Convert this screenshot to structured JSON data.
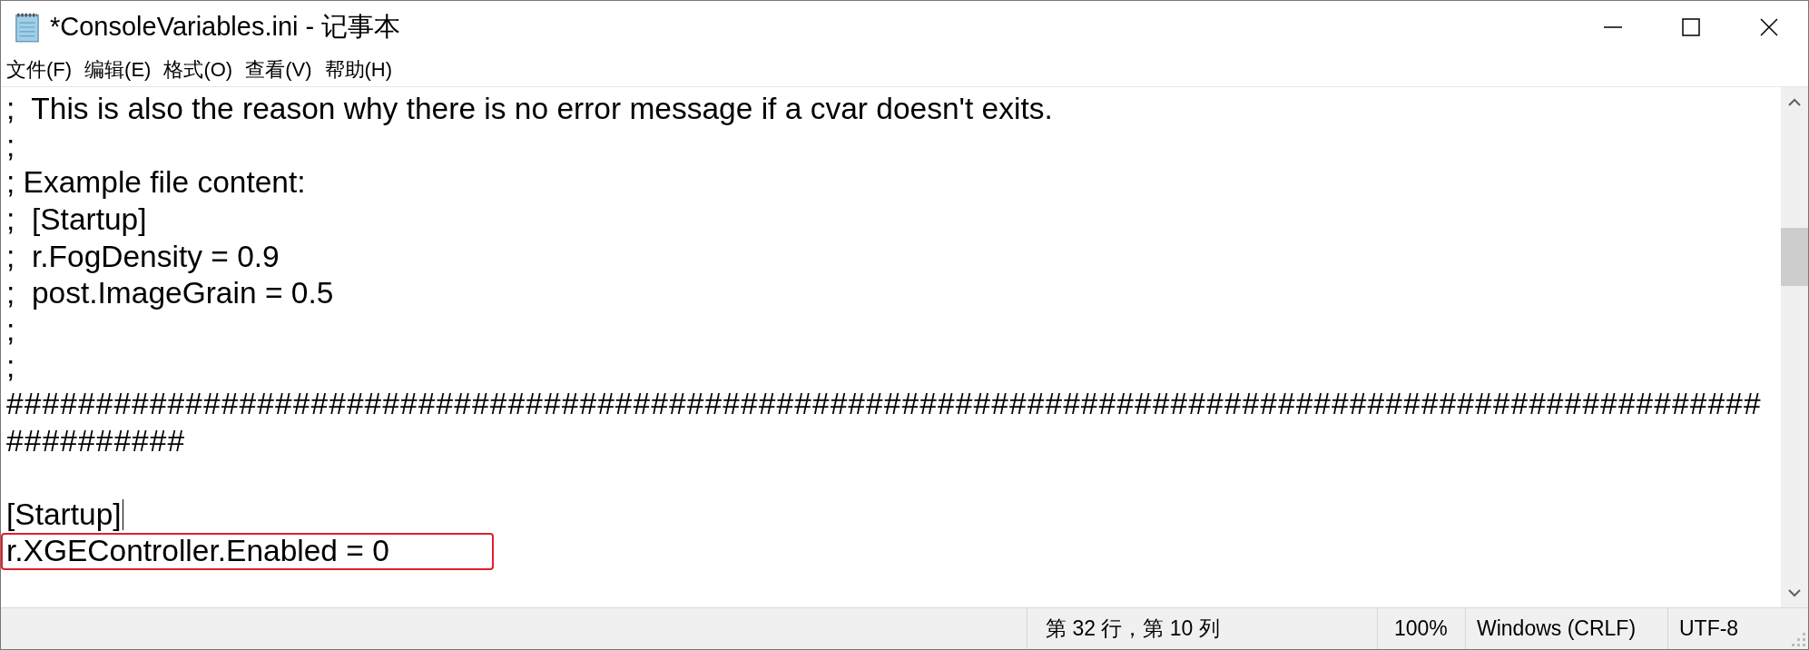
{
  "window": {
    "title": "*ConsoleVariables.ini - 记事本"
  },
  "menu": [
    {
      "label": "文件(F)"
    },
    {
      "label": "编辑(E)"
    },
    {
      "label": "格式(O)"
    },
    {
      "label": "查看(V)"
    },
    {
      "label": "帮助(H)"
    }
  ],
  "editor": {
    "lines": [
      {
        "kind": "text",
        "text": ";  This is also the reason why there is no error message if a cvar doesn't exits."
      },
      {
        "kind": "text",
        "text": ";"
      },
      {
        "kind": "text",
        "text": "; Example file content:"
      },
      {
        "kind": "text",
        "text": ";  [Startup]"
      },
      {
        "kind": "text",
        "text": ";  r.FogDensity = 0.9"
      },
      {
        "kind": "text",
        "text": ";  post.ImageGrain = 0.5"
      },
      {
        "kind": "text",
        "text": ";"
      },
      {
        "kind": "text",
        "text": ";"
      },
      {
        "kind": "rule",
        "text": "##################################################################################################"
      },
      {
        "kind": "rule",
        "text": "##########"
      },
      {
        "kind": "blank"
      },
      {
        "kind": "text",
        "text": "[Startup]",
        "caret": true
      },
      {
        "kind": "text",
        "text": "r.XGEController.Enabled = 0",
        "highlighted": true
      }
    ]
  },
  "status_bar": {
    "position": "第 32 行，第 10 列",
    "zoom": "100%",
    "line_ending": "Windows (CRLF)",
    "encoding": "UTF-8"
  }
}
